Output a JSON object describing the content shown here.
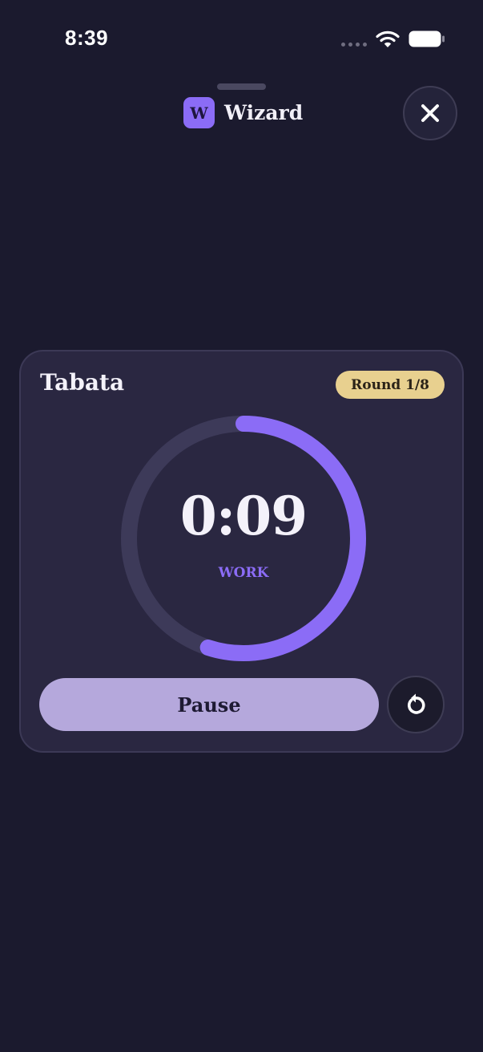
{
  "status_bar": {
    "time": "8:39",
    "icons": [
      "signal-dots-icon",
      "wifi-icon",
      "battery-icon"
    ]
  },
  "header": {
    "logo_letter": "W",
    "app_name": "Wizard",
    "close_icon": "close-icon"
  },
  "timer_card": {
    "title": "Tabata",
    "round_badge": "Round 1/8",
    "time_remaining": "0:09",
    "phase": "WORK",
    "progress": 0.55,
    "pause_label": "Pause",
    "reset_icon": "reset-icon"
  },
  "colors": {
    "background": "#1b1a2e",
    "card": "#2a2741",
    "accent": "#8b6cf6",
    "badge": "#e8d08f",
    "pause_button": "#b5a8dc",
    "ring_track": "#3d3a59"
  }
}
